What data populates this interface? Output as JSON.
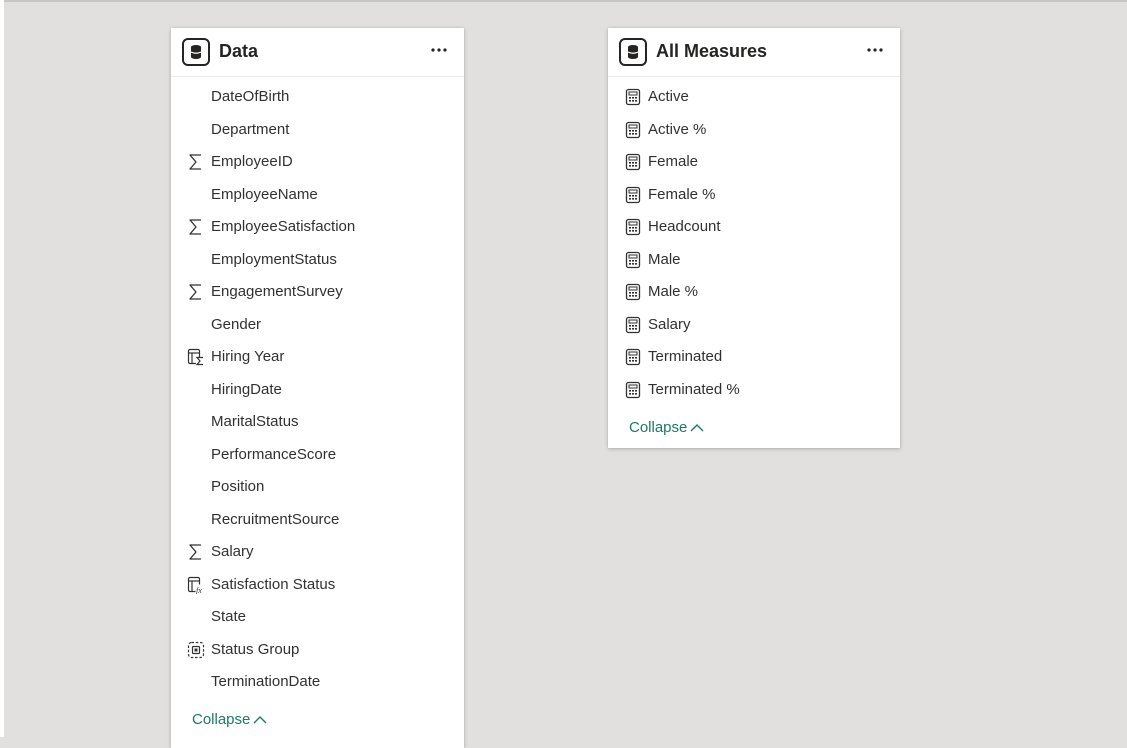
{
  "data_table": {
    "title": "Data",
    "collapse_label": "Collapse",
    "fields": [
      {
        "label": "DateOfBirth",
        "icon": "none"
      },
      {
        "label": "Department",
        "icon": "none"
      },
      {
        "label": "EmployeeID",
        "icon": "sigma-icon"
      },
      {
        "label": "EmployeeName",
        "icon": "none"
      },
      {
        "label": "EmployeeSatisfaction",
        "icon": "sigma-icon"
      },
      {
        "label": "EmploymentStatus",
        "icon": "none"
      },
      {
        "label": "EngagementSurvey",
        "icon": "sigma-icon"
      },
      {
        "label": "Gender",
        "icon": "none"
      },
      {
        "label": "Hiring Year",
        "icon": "calculated-column-sigma-icon"
      },
      {
        "label": "HiringDate",
        "icon": "none"
      },
      {
        "label": "MaritalStatus",
        "icon": "none"
      },
      {
        "label": "PerformanceScore",
        "icon": "none"
      },
      {
        "label": "Position",
        "icon": "none"
      },
      {
        "label": "RecruitmentSource",
        "icon": "none"
      },
      {
        "label": "Salary",
        "icon": "sigma-icon"
      },
      {
        "label": "Satisfaction Status",
        "icon": "calculated-column-fx-icon"
      },
      {
        "label": "State",
        "icon": "none"
      },
      {
        "label": "Status Group",
        "icon": "group-icon"
      },
      {
        "label": "TerminationDate",
        "icon": "none"
      }
    ]
  },
  "measures_table": {
    "title": "All Measures",
    "collapse_label": "Collapse",
    "fields": [
      {
        "label": "Active",
        "icon": "calculator-icon"
      },
      {
        "label": "Active %",
        "icon": "calculator-icon"
      },
      {
        "label": "Female",
        "icon": "calculator-icon"
      },
      {
        "label": "Female %",
        "icon": "calculator-icon"
      },
      {
        "label": "Headcount",
        "icon": "calculator-icon"
      },
      {
        "label": "Male",
        "icon": "calculator-icon"
      },
      {
        "label": "Male %",
        "icon": "calculator-icon"
      },
      {
        "label": "Salary",
        "icon": "calculator-icon"
      },
      {
        "label": "Terminated",
        "icon": "calculator-icon"
      },
      {
        "label": "Terminated %",
        "icon": "calculator-icon"
      }
    ]
  },
  "colors": {
    "canvas": "#e1e0df",
    "card": "#ffffff",
    "text": "#323130",
    "accent": "#1b7a64"
  }
}
